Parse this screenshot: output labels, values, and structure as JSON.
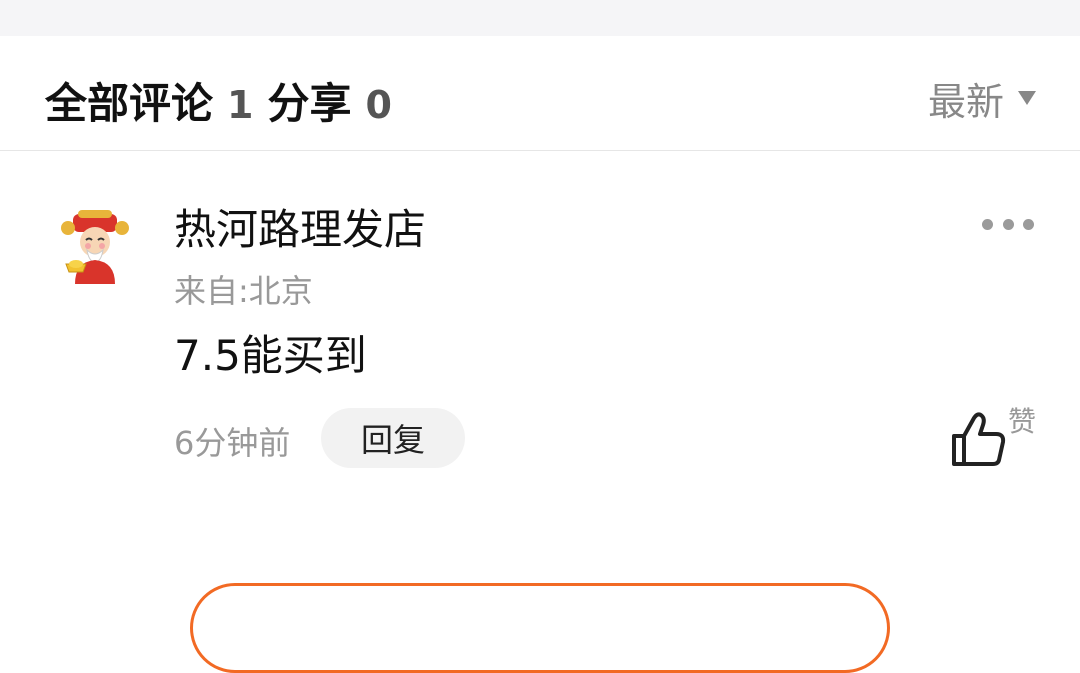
{
  "header": {
    "all_comments_label": "全部评论",
    "all_comments_count": "1",
    "shares_label": "分享",
    "shares_count": "0",
    "sort_label": "最新"
  },
  "comment": {
    "author": "热河路理发店",
    "location": "来自:北京",
    "text": "7.5能买到",
    "time": "6分钟前",
    "reply_label": "回复",
    "like_label": "赞",
    "avatar_icon": "god-of-wealth-avatar",
    "more_icon": "more-dots-icon",
    "like_icon": "thumbs-up-icon"
  },
  "colors": {
    "accent": "#f26a24",
    "secondary_text": "#999999",
    "primary_text": "#111111"
  }
}
